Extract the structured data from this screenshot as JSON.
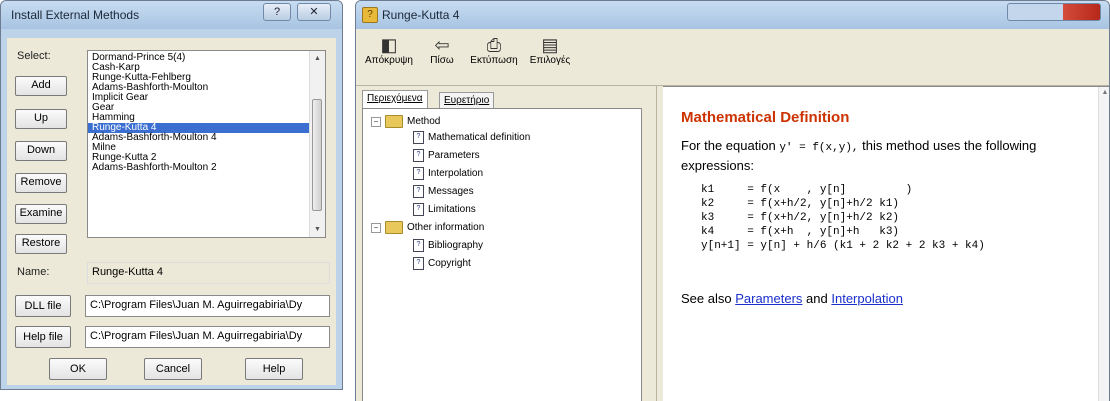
{
  "install_dialog": {
    "title": "Install External Methods",
    "title_buttons": [
      "?",
      "✕"
    ],
    "select_label": "Select:",
    "buttons": {
      "add": "Add",
      "up": "Up",
      "down": "Down",
      "remove": "Remove",
      "examine": "Examine",
      "restore": "Restore",
      "dll_file": "DLL file",
      "help_file": "Help file",
      "ok": "OK",
      "cancel": "Cancel",
      "help": "Help"
    },
    "methods": [
      "Dormand-Prince 5(4)",
      "Cash-Karp",
      "Runge-Kutta-Fehlberg",
      "Adams-Bashforth-Moulton",
      "Implicit Gear",
      "Gear",
      "Hamming",
      "Runge-Kutta 4",
      "Adams-Bashforth-Moulton 4",
      "Milne",
      "Runge-Kutta 2",
      "Adams-Bashforth-Moulton 2"
    ],
    "selected_method": "Runge-Kutta 4",
    "name_label": "Name:",
    "name_value": "Runge-Kutta 4",
    "dll_path": "C:\\Program Files\\Juan M. Aguirregabiria\\Dy",
    "help_path": "C:\\Program Files\\Juan M. Aguirregabiria\\Dy"
  },
  "help_window": {
    "title": "Runge-Kutta 4",
    "toolbar": [
      {
        "label": "Απόκρυψη",
        "icon": "hide-icon"
      },
      {
        "label": "Πίσω",
        "icon": "back-arrow-icon"
      },
      {
        "label": "Εκτύπωση",
        "icon": "print-icon"
      },
      {
        "label": "Επιλογές",
        "icon": "options-icon"
      }
    ],
    "tabs": [
      "Περιεχόμενα",
      "Ευρετήριο"
    ],
    "tree": {
      "method": "Method",
      "method_children": [
        "Mathematical definition",
        "Parameters",
        "Interpolation",
        "Messages",
        "Limitations"
      ],
      "other": "Other information",
      "other_children": [
        "Bibliography",
        "Copyright"
      ]
    },
    "content": {
      "heading": "Mathematical Definition",
      "intro_1": "For the equation",
      "equation": "y' = f(x,y),",
      "intro_2": "this method uses the",
      "intro_3": "following expressions:",
      "code_lines": [
        "k1     = f(x    , y[n]         )",
        "k2     = f(x+h/2, y[n]+h/2 k1)",
        "k3     = f(x+h/2, y[n]+h/2 k2)",
        "k4     = f(x+h  , y[n]+h   k3)",
        "y[n+1] = y[n] + h/6 (k1 + 2 k2 + 2 k3 + k4)"
      ],
      "see_also": "See also",
      "link_parameters": "Parameters",
      "and": "and",
      "link_interpolation": "Interpolation",
      "heading_color": "#cc3300"
    }
  }
}
